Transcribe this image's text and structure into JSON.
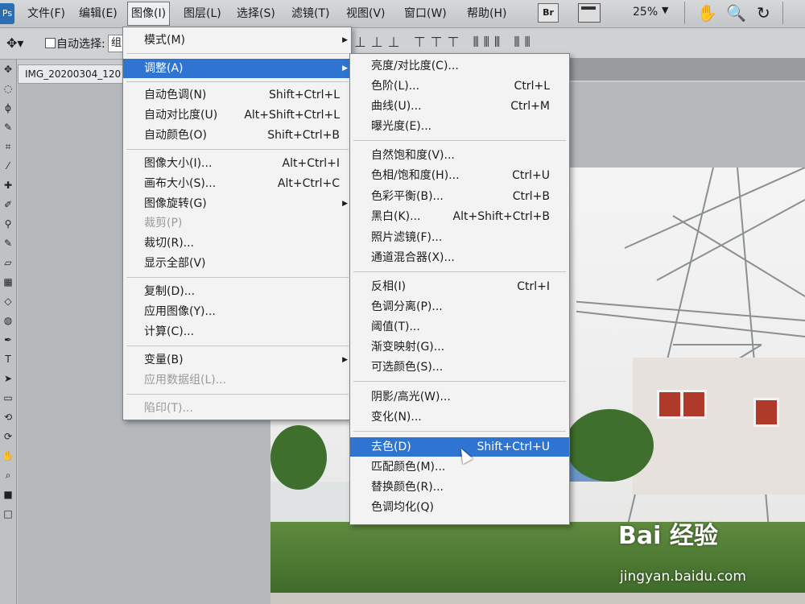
{
  "menubar": {
    "app_icon": "Ps",
    "items": [
      "文件(F)",
      "编辑(E)",
      "图像(I)",
      "图层(L)",
      "选择(S)",
      "滤镜(T)",
      "视图(V)",
      "窗口(W)",
      "帮助(H)"
    ],
    "bridge_label": "Br",
    "zoom": "25%"
  },
  "options_bar": {
    "auto_select_label": "自动选择:",
    "auto_select_value": "组"
  },
  "document": {
    "tab_title": "IMG_20200304_120"
  },
  "image_menu": {
    "items": [
      {
        "label": "模式(M)",
        "shortcut": "",
        "submenu": true,
        "disabled": false
      },
      {
        "label": "调整(A)",
        "shortcut": "",
        "submenu": true,
        "disabled": false
      },
      {
        "label": "自动色调(N)",
        "shortcut": "Shift+Ctrl+L"
      },
      {
        "label": "自动对比度(U)",
        "shortcut": "Alt+Shift+Ctrl+L"
      },
      {
        "label": "自动颜色(O)",
        "shortcut": "Shift+Ctrl+B"
      },
      {
        "label": "图像大小(I)...",
        "shortcut": "Alt+Ctrl+I"
      },
      {
        "label": "画布大小(S)...",
        "shortcut": "Alt+Ctrl+C"
      },
      {
        "label": "图像旋转(G)",
        "shortcut": ""
      },
      {
        "label": "裁剪(P)",
        "shortcut": ""
      },
      {
        "label": "裁切(R)...",
        "shortcut": ""
      },
      {
        "label": "显示全部(V)",
        "shortcut": ""
      },
      {
        "label": "复制(D)...",
        "shortcut": ""
      },
      {
        "label": "应用图像(Y)...",
        "shortcut": ""
      },
      {
        "label": "计算(C)...",
        "shortcut": ""
      },
      {
        "label": "变量(B)",
        "shortcut": ""
      },
      {
        "label": "应用数据组(L)...",
        "shortcut": ""
      },
      {
        "label": "陷印(T)...",
        "shortcut": ""
      }
    ]
  },
  "adjust_submenu": {
    "items": [
      {
        "label": "亮度/对比度(C)...",
        "shortcut": ""
      },
      {
        "label": "色阶(L)...",
        "shortcut": "Ctrl+L"
      },
      {
        "label": "曲线(U)...",
        "shortcut": "Ctrl+M"
      },
      {
        "label": "曝光度(E)...",
        "shortcut": ""
      },
      {
        "label": "自然饱和度(V)...",
        "shortcut": ""
      },
      {
        "label": "色相/饱和度(H)...",
        "shortcut": "Ctrl+U"
      },
      {
        "label": "色彩平衡(B)...",
        "shortcut": "Ctrl+B"
      },
      {
        "label": "黑白(K)...",
        "shortcut": "Alt+Shift+Ctrl+B"
      },
      {
        "label": "照片滤镜(F)...",
        "shortcut": ""
      },
      {
        "label": "通道混合器(X)...",
        "shortcut": ""
      },
      {
        "label": "反相(I)",
        "shortcut": "Ctrl+I"
      },
      {
        "label": "色调分离(P)...",
        "shortcut": ""
      },
      {
        "label": "阈值(T)...",
        "shortcut": ""
      },
      {
        "label": "渐变映射(G)...",
        "shortcut": ""
      },
      {
        "label": "可选颜色(S)...",
        "shortcut": ""
      },
      {
        "label": "阴影/高光(W)...",
        "shortcut": ""
      },
      {
        "label": "变化(N)...",
        "shortcut": ""
      },
      {
        "label": "去色(D)",
        "shortcut": "Shift+Ctrl+U"
      },
      {
        "label": "匹配颜色(M)...",
        "shortcut": ""
      },
      {
        "label": "替换颜色(R)...",
        "shortcut": ""
      },
      {
        "label": "色调均化(Q)",
        "shortcut": ""
      }
    ]
  },
  "watermark": {
    "brand": "Bai 经验",
    "url": "jingyan.baidu.com"
  },
  "colors": {
    "highlight": "#2f74d0",
    "menu_bg": "#f3f3f3"
  }
}
